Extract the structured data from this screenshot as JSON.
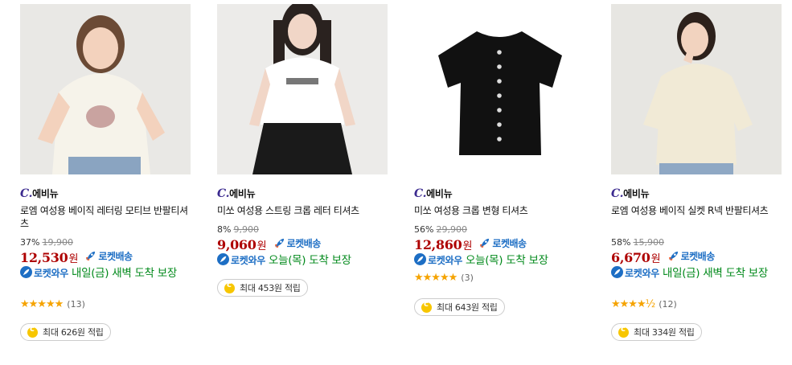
{
  "products": [
    {
      "brand": "에비뉴",
      "title": "로엠 여성용 베이직 레터링 모티브 반팔티셔츠",
      "discount": "37%",
      "original_price": "19,900",
      "price": "12,530",
      "won": "원",
      "rocket_label": "로켓배송",
      "wow_label": "로켓와우",
      "delivery_text": "내일(금) 새벽 도착 보장",
      "stars": "★★★★★",
      "review_count": "(13)",
      "reward": "최대 626원 적립"
    },
    {
      "brand": "에비뉴",
      "title": "미쏘 여성용 스트링 크롭 레터 티셔츠",
      "discount": "8%",
      "original_price": "9,900",
      "price": "9,060",
      "won": "원",
      "rocket_label": "로켓배송",
      "wow_label": "로켓와우",
      "delivery_text": "오늘(목) 도착 보장",
      "reward": "최대 453원 적립"
    },
    {
      "brand": "에비뉴",
      "title": "미쏘 여성용 크롭 변형 티셔츠",
      "discount": "56%",
      "original_price": "29,900",
      "price": "12,860",
      "won": "원",
      "rocket_label": "로켓배송",
      "wow_label": "로켓와우",
      "delivery_text": "오늘(목) 도착 보장",
      "stars": "★★★★★",
      "review_count": "(3)",
      "reward": "최대 643원 적립"
    },
    {
      "brand": "에비뉴",
      "title": "로엠 여성용 베이직 실켓 R넥 반팔티셔츠",
      "discount": "58%",
      "original_price": "15,900",
      "price": "6,670",
      "won": "원",
      "rocket_label": "로켓배송",
      "wow_label": "로켓와우",
      "delivery_text": "내일(금) 새벽 도착 보장",
      "stars": "★★★★½",
      "review_count": "(12)",
      "reward": "최대 334원 적립"
    }
  ],
  "brand_prefix": "C.",
  "colors": {
    "price": "#ae0000",
    "rocket": "#1d6ec4",
    "delivery": "#00891a",
    "star": "#f5a300",
    "brand_mark": "#3b2a8f"
  }
}
